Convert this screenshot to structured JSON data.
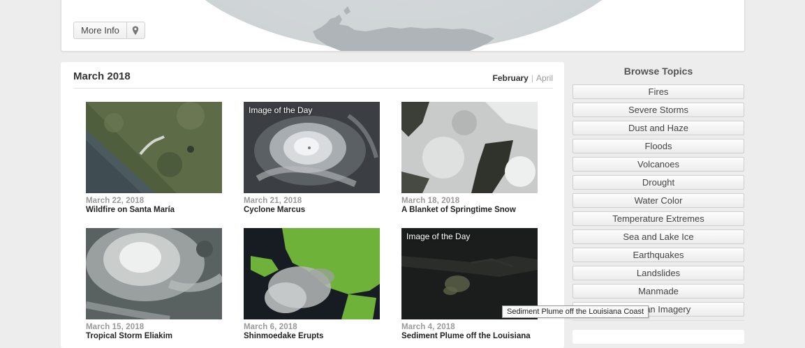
{
  "top_panel": {
    "more_info_label": "More Info",
    "location_icon": "map-pin-icon"
  },
  "archive": {
    "month_title": "March 2018",
    "nav": {
      "prev_label": "February",
      "separator": "|",
      "next_label": "April"
    },
    "cards": [
      {
        "date": "March 22, 2018",
        "title": "Wildfire on Santa María",
        "image_of_the_day": ""
      },
      {
        "date": "March 21, 2018",
        "title": "Cyclone Marcus",
        "image_of_the_day": "Image of the Day"
      },
      {
        "date": "March 18, 2018",
        "title": "A Blanket of Springtime Snow",
        "image_of_the_day": ""
      },
      {
        "date": "March 15, 2018",
        "title": "Tropical Storm Eliakim",
        "image_of_the_day": ""
      },
      {
        "date": "March 6, 2018",
        "title": "Shinmoedake Erupts",
        "image_of_the_day": ""
      },
      {
        "date": "March 4, 2018",
        "title": "Sediment Plume off the Louisiana",
        "image_of_the_day": "Image of the Day"
      }
    ]
  },
  "sidebar": {
    "title": "Browse Topics",
    "topics": [
      "Fires",
      "Severe Storms",
      "Dust and Haze",
      "Floods",
      "Volcanoes",
      "Drought",
      "Water Color",
      "Temperature Extremes",
      "Sea and Lake Ice",
      "Earthquakes",
      "Landslides",
      "Manmade",
      "Human Imagery"
    ]
  },
  "tooltip": {
    "text": "Sediment Plume off the Louisiana Coast"
  }
}
